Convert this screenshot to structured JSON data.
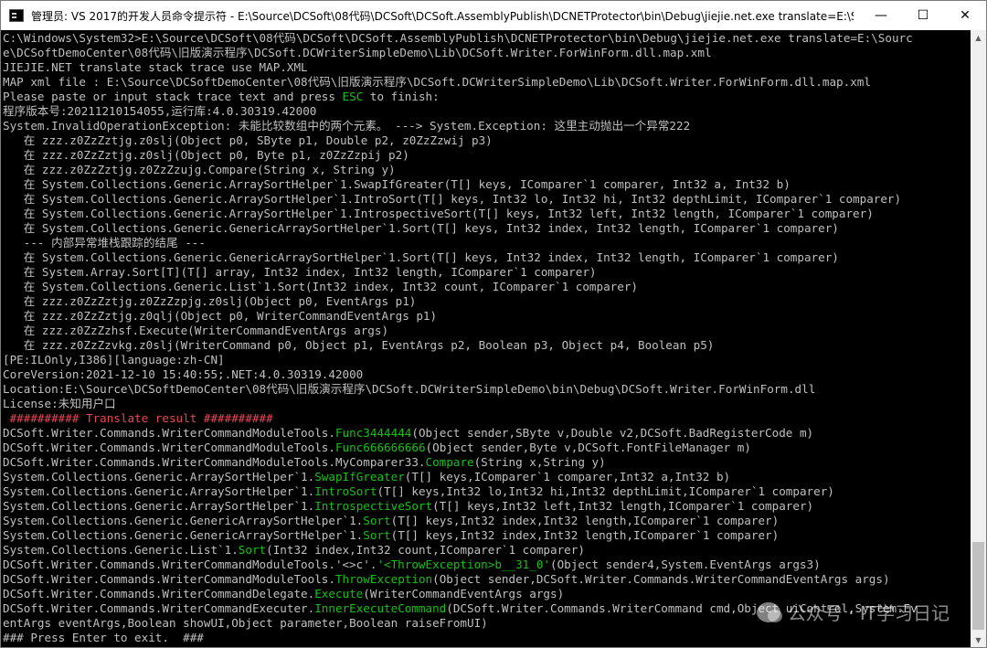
{
  "window": {
    "title": "管理员: VS 2017的开发人员命令提示符 - E:\\Source\\DCSoft\\08代码\\DCSoft\\DCSoft.AssemblyPublish\\DCNETProtector\\bin\\Debug\\jiejie.net.exe  translate=E:\\S...",
    "minimize": "—",
    "maximize": "☐",
    "close": "✕"
  },
  "colors": {
    "green": "#13c313",
    "red": "#e74856",
    "text": "#c0c0c0"
  },
  "watermark": "公众号 · IT学习日记",
  "console": {
    "lines": [
      [
        {
          "t": "C:\\Windows\\System32>E:\\Source\\DCSoft\\08代码\\DCSoft\\DCSoft.AssemblyPublish\\DCNETProtector\\bin\\Debug\\jiejie.net.exe translate=E:\\Sourc"
        }
      ],
      [
        {
          "t": "e\\DCSoftDemoCenter\\08代码\\旧版演示程序\\DCSoft.DCWriterSimpleDemo\\Lib\\DCSoft.Writer.ForWinForm.dll.map.xml"
        }
      ],
      [
        {
          "t": "JIEJIE.NET translate stack trace use MAP.XML"
        }
      ],
      [
        {
          "t": "MAP xml file : E:\\Source\\DCSoftDemoCenter\\08代码\\旧版演示程序\\DCSoft.DCWriterSimpleDemo\\Lib\\DCSoft.Writer.ForWinForm.dll.map.xml"
        }
      ],
      [
        {
          "t": "Please paste or input stack trace text and press "
        },
        {
          "t": "ESC",
          "c": "g"
        },
        {
          "t": " to finish:"
        }
      ],
      [
        {
          "t": "程序版本号:20211210154055,运行库:4.0.30319.42000"
        }
      ],
      [
        {
          "t": "System.InvalidOperationException: 未能比较数组中的两个元素。 ---> System.Exception: 这里主动抛出一个异常222"
        }
      ],
      [
        {
          "t": "   在 zzz.z0ZzZztjg.z0slj(Object p0, SByte p1, Double p2, z0ZzZzwij p3)"
        }
      ],
      [
        {
          "t": "   在 zzz.z0ZzZztjg.z0slj(Object p0, Byte p1, z0ZzZzpij p2)"
        }
      ],
      [
        {
          "t": "   在 zzz.z0ZzZztjg.z0ZzZzujg.Compare(String x, String y)"
        }
      ],
      [
        {
          "t": "   在 System.Collections.Generic.ArraySortHelper`1.SwapIfGreater(T[] keys, IComparer`1 comparer, Int32 a, Int32 b)"
        }
      ],
      [
        {
          "t": "   在 System.Collections.Generic.ArraySortHelper`1.IntroSort(T[] keys, Int32 lo, Int32 hi, Int32 depthLimit, IComparer`1 comparer)"
        }
      ],
      [
        {
          "t": "   在 System.Collections.Generic.ArraySortHelper`1.IntrospectiveSort(T[] keys, Int32 left, Int32 length, IComparer`1 comparer)"
        }
      ],
      [
        {
          "t": "   在 System.Collections.Generic.GenericArraySortHelper`1.Sort(T[] keys, Int32 index, Int32 length, IComparer`1 comparer)"
        }
      ],
      [
        {
          "t": "   --- 内部异常堆栈跟踪的结尾 ---"
        }
      ],
      [
        {
          "t": "   在 System.Collections.Generic.GenericArraySortHelper`1.Sort(T[] keys, Int32 index, Int32 length, IComparer`1 comparer)"
        }
      ],
      [
        {
          "t": "   在 System.Array.Sort[T](T[] array, Int32 index, Int32 length, IComparer`1 comparer)"
        }
      ],
      [
        {
          "t": "   在 System.Collections.Generic.List`1.Sort(Int32 index, Int32 count, IComparer`1 comparer)"
        }
      ],
      [
        {
          "t": "   在 zzz.z0ZzZztjg.z0ZzZzpjg.z0slj(Object p0, EventArgs p1)"
        }
      ],
      [
        {
          "t": "   在 zzz.z0ZzZztjg.z0qlj(Object p0, WriterCommandEventArgs p1)"
        }
      ],
      [
        {
          "t": "   在 zzz.z0ZzZzhsf.Execute(WriterCommandEventArgs args)"
        }
      ],
      [
        {
          "t": "   在 zzz.z0ZzZzvkg.z0slj(WriterCommand p0, Object p1, EventArgs p2, Boolean p3, Object p4, Boolean p5)"
        }
      ],
      [
        {
          "t": "[PE:ILOnly,I386][language:zh-CN]"
        }
      ],
      [
        {
          "t": "CoreVersion:2021-12-10 15:40:55;.NET:4.0.30319.42000"
        }
      ],
      [
        {
          "t": "Location:E:\\Source\\DCSoftDemoCenter\\08代码\\旧版演示程序\\DCSoft.DCWriterSimpleDemo\\bin\\Debug\\DCSoft.Writer.ForWinForm.dll"
        }
      ],
      [
        {
          "t": "License:未知用户口"
        }
      ],
      [
        {
          "t": " ########## Translate result ##########",
          "c": "r"
        }
      ],
      [
        {
          "t": "DCSoft.Writer.Commands.WriterCommandModuleTools."
        },
        {
          "t": "Func3444444",
          "c": "g"
        },
        {
          "t": "(Object sender,SByte v,Double v2,DCSoft.BadRegisterCode m)"
        }
      ],
      [
        {
          "t": "DCSoft.Writer.Commands.WriterCommandModuleTools."
        },
        {
          "t": "Func666666666",
          "c": "g"
        },
        {
          "t": "(Object sender,Byte v,DCSoft.FontFileManager m)"
        }
      ],
      [
        {
          "t": "DCSoft.Writer.Commands.WriterCommandModuleTools.MyComparer33."
        },
        {
          "t": "Compare",
          "c": "g"
        },
        {
          "t": "(String x,String y)"
        }
      ],
      [
        {
          "t": "System.Collections.Generic.ArraySortHelper`1."
        },
        {
          "t": "SwapIfGreater",
          "c": "g"
        },
        {
          "t": "(T[] keys,IComparer`1 comparer,Int32 a,Int32 b)"
        }
      ],
      [
        {
          "t": "System.Collections.Generic.ArraySortHelper`1."
        },
        {
          "t": "IntroSort",
          "c": "g"
        },
        {
          "t": "(T[] keys,Int32 lo,Int32 hi,Int32 depthLimit,IComparer`1 comparer)"
        }
      ],
      [
        {
          "t": "System.Collections.Generic.ArraySortHelper`1."
        },
        {
          "t": "IntrospectiveSort",
          "c": "g"
        },
        {
          "t": "(T[] keys,Int32 left,Int32 length,IComparer`1 comparer)"
        }
      ],
      [
        {
          "t": "System.Collections.Generic.GenericArraySortHelper`1."
        },
        {
          "t": "Sort",
          "c": "g"
        },
        {
          "t": "(T[] keys,Int32 index,Int32 length,IComparer`1 comparer)"
        }
      ],
      [
        {
          "t": "System.Collections.Generic.GenericArraySortHelper`1."
        },
        {
          "t": "Sort",
          "c": "g"
        },
        {
          "t": "(T[] keys,Int32 index,Int32 length,IComparer`1 comparer)"
        }
      ],
      [
        {
          "t": "System.Collections.Generic.List`1."
        },
        {
          "t": "Sort",
          "c": "g"
        },
        {
          "t": "(Int32 index,Int32 count,IComparer`1 comparer)"
        }
      ],
      [
        {
          "t": "DCSoft.Writer.Commands.WriterCommandModuleTools.'<>c'."
        },
        {
          "t": "'<ThrowException>b__31_0'",
          "c": "g"
        },
        {
          "t": "(Object sender4,System.EventArgs args3)"
        }
      ],
      [
        {
          "t": "DCSoft.Writer.Commands.WriterCommandModuleTools."
        },
        {
          "t": "ThrowException",
          "c": "g"
        },
        {
          "t": "(Object sender,DCSoft.Writer.Commands.WriterCommandEventArgs args)"
        }
      ],
      [
        {
          "t": "DCSoft.Writer.Commands.WriterCommandDelegate."
        },
        {
          "t": "Execute",
          "c": "g"
        },
        {
          "t": "(WriterCommandEventArgs args)"
        }
      ],
      [
        {
          "t": "DCSoft.Writer.Commands.WriterCommandExecuter."
        },
        {
          "t": "InnerExecuteCommand",
          "c": "g"
        },
        {
          "t": "(DCSoft.Writer.Commands.WriterCommand cmd,Object uiControl,System.Ev"
        }
      ],
      [
        {
          "t": "entArgs eventArgs,Boolean showUI,Object parameter,Boolean raiseFromUI)"
        }
      ],
      [
        {
          "t": "### Press Enter to exit.  ###"
        }
      ]
    ]
  }
}
